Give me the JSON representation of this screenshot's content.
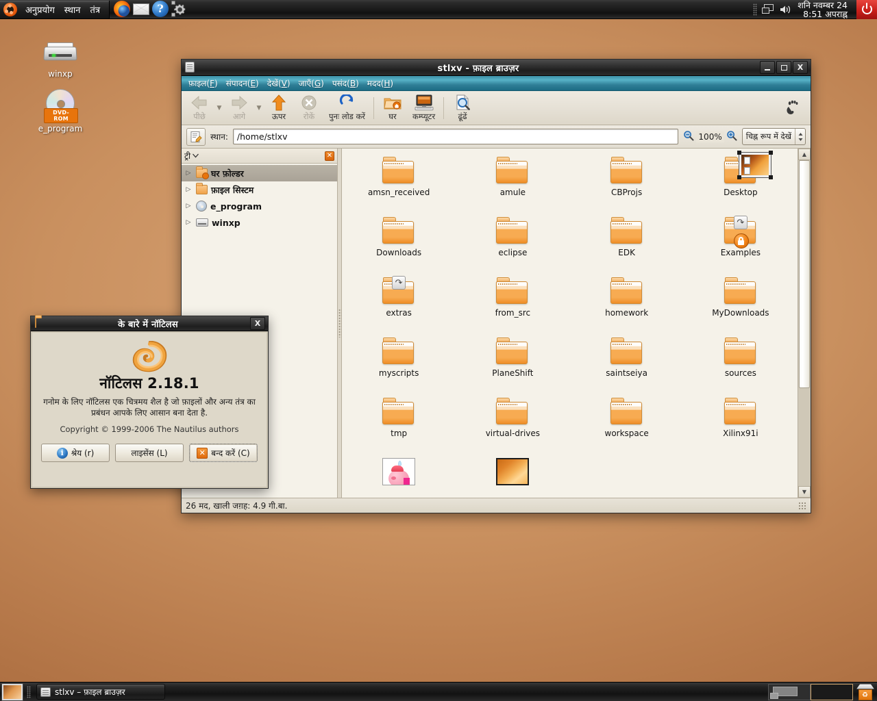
{
  "top_panel": {
    "menus": [
      "अनुप्रयोग",
      "स्थान",
      "तंत्र"
    ],
    "launchers": [
      {
        "name": "firefox-icon",
        "tip": "Firefox"
      },
      {
        "name": "mail-icon",
        "tip": "Evolution Mail"
      },
      {
        "name": "help-icon",
        "tip": "Help",
        "glyph": "?"
      },
      {
        "name": "gear-icon",
        "tip": "System Settings"
      }
    ],
    "tray": {
      "window_list_icon": "window-list-icon",
      "volume_icon": "volume-icon",
      "clock_date": "शनि  नवम्बर 24",
      "clock_time": "8:51 अपराह्न",
      "power_icon": "power-icon"
    }
  },
  "desktop": {
    "icons": [
      {
        "label": "winxp",
        "icon": "hard-drive-icon"
      },
      {
        "label": "e_program",
        "icon": "cdrom-icon",
        "badge": "DVD-ROM"
      }
    ]
  },
  "nautilus": {
    "title": "stlxv - फ़ाइल ब्राउज़र",
    "window_buttons": {
      "minimize": "_",
      "maximize": "□",
      "close": "X"
    },
    "menubar": [
      {
        "label": "फ़ाइल",
        "mnemonic": "F"
      },
      {
        "label": "संपादन",
        "mnemonic": "E"
      },
      {
        "label": "देखें",
        "mnemonic": "V"
      },
      {
        "label": "जाएँ",
        "mnemonic": "G"
      },
      {
        "label": "पसंद",
        "mnemonic": "B"
      },
      {
        "label": "मदद",
        "mnemonic": "H"
      }
    ],
    "toolbar": [
      {
        "label": "पीछे",
        "icon": "back-arrow-icon",
        "disabled": true,
        "has_caret": true
      },
      {
        "label": "आगे",
        "icon": "forward-arrow-icon",
        "disabled": true,
        "has_caret": true
      },
      {
        "label": "ऊपर",
        "icon": "up-arrow-icon",
        "disabled": false
      },
      {
        "label": "रोकें",
        "icon": "stop-icon",
        "disabled": true
      },
      {
        "label": "पुनः लोड करें",
        "icon": "reload-icon",
        "disabled": false
      },
      {
        "label": "घर",
        "icon": "home-folder-icon",
        "disabled": false
      },
      {
        "label": "कम्प्यूटर",
        "icon": "computer-icon",
        "disabled": false
      },
      {
        "label": "ढूंढें",
        "icon": "search-icon",
        "disabled": false
      }
    ],
    "toolbar_logo": "gnome-foot-icon",
    "location": {
      "toggle_icon": "location-toggle-icon",
      "label": "स्थान:",
      "value": "/home/stlxv",
      "zoom_out_icon": "zoom-out-icon",
      "zoom_level": "100%",
      "zoom_in_icon": "zoom-in-icon",
      "view_mode": "चिह्न रूप में देखें"
    },
    "sidebar": {
      "selector": "ट्री",
      "close_icon": "close-sidebar-icon",
      "items": [
        {
          "label": "घर फ़ोल्डर",
          "icon": "home-folder-icon",
          "selected": true
        },
        {
          "label": "फ़ाइल सिस्टम",
          "icon": "folder-icon",
          "selected": false
        },
        {
          "label": "e_program",
          "icon": "cdrom-icon",
          "selected": false
        },
        {
          "label": "winxp",
          "icon": "hard-drive-icon",
          "selected": false
        }
      ]
    },
    "files": [
      {
        "name": "amsn_received",
        "type": "folder"
      },
      {
        "name": "amule",
        "type": "folder"
      },
      {
        "name": "CBProjs",
        "type": "folder"
      },
      {
        "name": "Desktop",
        "type": "folder",
        "emblem": "desktop-preview",
        "selected": true
      },
      {
        "name": "Downloads",
        "type": "folder"
      },
      {
        "name": "eclipse",
        "type": "folder"
      },
      {
        "name": "EDK",
        "type": "folder"
      },
      {
        "name": "Examples",
        "type": "folder",
        "emblem": "symlink-lock"
      },
      {
        "name": "extras",
        "type": "folder",
        "emblem": "symlink"
      },
      {
        "name": "from_src",
        "type": "folder"
      },
      {
        "name": "homework",
        "type": "folder"
      },
      {
        "name": "MyDownloads",
        "type": "folder"
      },
      {
        "name": "myscripts",
        "type": "folder"
      },
      {
        "name": "PlaneShift",
        "type": "folder"
      },
      {
        "name": "saintseiya",
        "type": "folder"
      },
      {
        "name": "sources",
        "type": "folder"
      },
      {
        "name": "tmp",
        "type": "folder"
      },
      {
        "name": "virtual-drives",
        "type": "folder"
      },
      {
        "name": "workspace",
        "type": "folder"
      },
      {
        "name": "Xilinx91i",
        "type": "folder"
      },
      {
        "name": "",
        "type": "image-kirby"
      },
      {
        "name": "",
        "type": "image-wallpaper"
      }
    ],
    "statusbar": "26 मद, खाली जग़ह: 4.9 गी.बा."
  },
  "about_dialog": {
    "title": "के बारे में नॉटिलस",
    "close_button": "X",
    "logo": "nautilus-shell-icon",
    "app_title": "नॉटिलस 2.18.1",
    "description": "गनोम के लिए नॉटिलस एक चित्रमय शैल है जो फ़ाइलों और अन्य तंत्र का प्रबंधन आपके लिए आसान बना देता है.",
    "copyright": "Copyright © 1999-2006 The Nautilus authors",
    "buttons": [
      {
        "label": "श्रेय (r)",
        "icon": "info-icon",
        "focused": false
      },
      {
        "label": "लाइसेंस (L)",
        "icon": null,
        "focused": false
      },
      {
        "label": "बन्द करें (C)",
        "icon": "close-x-icon",
        "focused": true
      }
    ]
  },
  "bottom_panel": {
    "show_desktop_icon": "show-desktop-icon",
    "tasks": [
      {
        "label": "stlxv – फ़ाइल ब्राउज़र",
        "icon": "file-browser-icon",
        "active": true
      }
    ],
    "workspaces": [
      {
        "index": 1,
        "active": true
      },
      {
        "index": 2,
        "active": false
      }
    ],
    "trash_icon": "trash-icon"
  },
  "colors": {
    "accent_orange": "#e8740c",
    "menubar_teal": "#3d8fa6",
    "desktop_brown": "#b87b4c",
    "panel_black": "#1a1a1a"
  }
}
